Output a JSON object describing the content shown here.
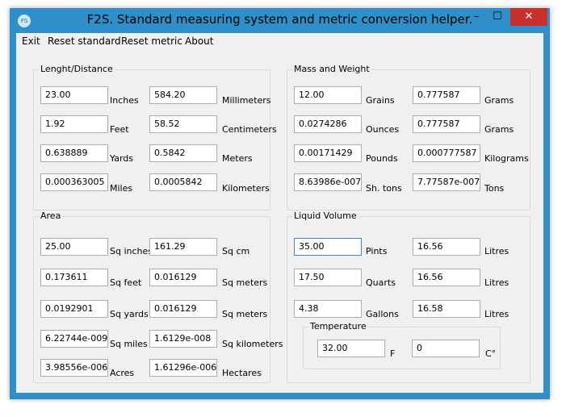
{
  "window": {
    "icon_text": "FS",
    "title": "F2S.  Standard measuring system and metric conversion helper.",
    "minimize_glyph": "–",
    "maximize_glyph": "☐",
    "close_glyph": "✕"
  },
  "menu": [
    "Exit",
    "Reset standard",
    "Reset metric",
    "About"
  ],
  "length": {
    "title": "Lenght/Distance",
    "rows": [
      {
        "std": "23.00",
        "std_unit": "Inches",
        "met": "584.20",
        "met_unit": "Millimeters"
      },
      {
        "std": "1.92",
        "std_unit": "Feet",
        "met": "58.52",
        "met_unit": "Centimeters"
      },
      {
        "std": "0.638889",
        "std_unit": "Yards",
        "met": "0.5842",
        "met_unit": "Meters"
      },
      {
        "std": "0.000363005",
        "std_unit": "Miles",
        "met": "0.0005842",
        "met_unit": "Kilometers"
      }
    ]
  },
  "mass": {
    "title": "Mass and Weight",
    "rows": [
      {
        "std": "12.00",
        "std_unit": "Grains",
        "met": "0.777587",
        "met_unit": "Grams"
      },
      {
        "std": "0.0274286",
        "std_unit": "Ounces",
        "met": "0.777587",
        "met_unit": "Grams"
      },
      {
        "std": "0.00171429",
        "std_unit": "Pounds",
        "met": "0.000777587",
        "met_unit": "Kilograms"
      },
      {
        "std": "8.63986e-007",
        "std_unit": "Sh. tons",
        "met": "7.77587e-007",
        "met_unit": "Tons"
      }
    ]
  },
  "area": {
    "title": "Area",
    "rows": [
      {
        "std": "25.00",
        "std_unit": "Sq inches",
        "met": "161.29",
        "met_unit": "Sq cm"
      },
      {
        "std": "0.173611",
        "std_unit": "Sq feet",
        "met": "0.016129",
        "met_unit": "Sq meters"
      },
      {
        "std": "0.0192901",
        "std_unit": "Sq yards",
        "met": "0.016129",
        "met_unit": "Sq meters"
      },
      {
        "std": "6.22744e-009",
        "std_unit": "Sq miles",
        "met": "1.6129e-008",
        "met_unit": "Sq kilometers"
      },
      {
        "std": "3.98556e-006",
        "std_unit": "Acres",
        "met": "1.61296e-006",
        "met_unit": "Hectares"
      }
    ]
  },
  "liquid": {
    "title": "Liquid Volume",
    "rows": [
      {
        "std": "35.00",
        "std_unit": "Pints",
        "met": "16.56",
        "met_unit": "Litres"
      },
      {
        "std": "17.50",
        "std_unit": "Quarts",
        "met": "16.56",
        "met_unit": "Litres"
      },
      {
        "std": "4.38",
        "std_unit": "Gallons",
        "met": "16.58",
        "met_unit": "Litres"
      }
    ]
  },
  "temperature": {
    "title": "Temperature",
    "f_value": "32.00",
    "f_unit": "F",
    "c_value": "0",
    "c_unit": "C°"
  }
}
